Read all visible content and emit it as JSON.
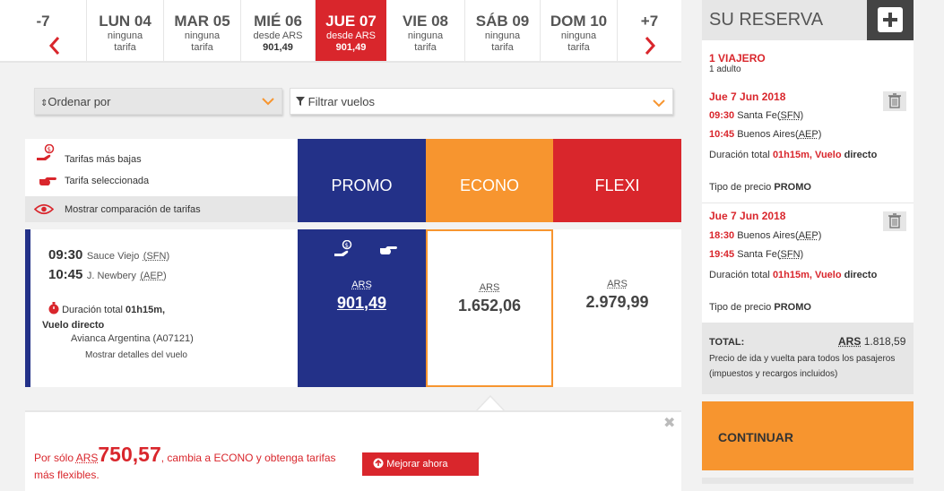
{
  "dates": [
    {
      "day": "-7",
      "sub1": "",
      "sub2": "",
      "active": false,
      "nav": "prev"
    },
    {
      "day": "LUN 04",
      "sub1": "ninguna",
      "sub2": "tarifa",
      "active": false
    },
    {
      "day": "MAR 05",
      "sub1": "ninguna",
      "sub2": "tarifa",
      "active": false
    },
    {
      "day": "MIÉ 06",
      "sub1": "desde ARS",
      "sub2": "901,49",
      "active": false
    },
    {
      "day": "JUE 07",
      "sub1": "desde ARS",
      "sub2": "901,49",
      "active": true
    },
    {
      "day": "VIE 08",
      "sub1": "ninguna",
      "sub2": "tarifa",
      "active": false
    },
    {
      "day": "SÁB 09",
      "sub1": "ninguna",
      "sub2": "tarifa",
      "active": false
    },
    {
      "day": "DOM 10",
      "sub1": "ninguna",
      "sub2": "tarifa",
      "active": false
    },
    {
      "day": "+7",
      "sub1": "",
      "sub2": "",
      "active": false,
      "nav": "next"
    }
  ],
  "filters": {
    "sort_label": "Ordenar por",
    "filter_label": "Filtrar vuelos"
  },
  "legend": {
    "lowest": "Tarifas más bajas",
    "selected": "Tarifa seleccionada",
    "compare": "Mostrar comparación de tarifas"
  },
  "fares": {
    "promo": "PROMO",
    "econo": "ECONO",
    "flexi": "FLEXI"
  },
  "colors": {
    "promo": "#233188",
    "econo": "#f7952f",
    "flexi": "#d9262c",
    "accent_red": "#d9262c"
  },
  "flight": {
    "dep_time": "09:30",
    "dep_place": "Sauce Viejo",
    "dep_code": "SFN",
    "arr_time": "10:45",
    "arr_place": "J. Newbery",
    "arr_code": "AEP",
    "duration_label": "Duración total",
    "duration_value": "01h15m,",
    "direct": "Vuelo directo",
    "carrier": "Avianca Argentina (A07121)",
    "details_link": "Mostrar detalles del vuelo",
    "promo_cur": "ARS",
    "promo_price": "901,49",
    "econo_cur": "ARS",
    "econo_price": "1.652,06",
    "flexi_cur": "ARS",
    "flexi_price": "2.979,99"
  },
  "upsell": {
    "prefix": "Por sólo",
    "cur": "ARS",
    "amount": "750,57",
    "suffix": ", cambia a ECONO y obtenga tarifas",
    "suffix2": "más flexibles.",
    "button": "Mejorar ahora"
  },
  "sidebar": {
    "title": "SU RESERVA",
    "travelers": "1 VIAJERO",
    "adults": "1 adulto",
    "leg1": {
      "date": "Jue 7 Jun 2018",
      "dep_time": "09:30",
      "dep_place": "Santa Fe",
      "dep_code": "SFN",
      "arr_time": "10:45",
      "arr_place": "Buenos Aires",
      "arr_code": "AEP",
      "duration_label": "Duración total",
      "duration_value": "01h15m, Vuelo",
      "duration_value2": "directo",
      "price_type_label": "Tipo de precio",
      "price_type": "PROMO"
    },
    "leg2": {
      "date": "Jue 7 Jun 2018",
      "dep_time": "18:30",
      "dep_place": "Buenos Aires",
      "dep_code": "AEP",
      "arr_time": "19:45",
      "arr_place": "Santa Fe",
      "arr_code": "SFN",
      "duration_label": "Duración total",
      "duration_value": "01h15m, Vuelo",
      "duration_value2": "directo",
      "price_type_label": "Tipo de precio",
      "price_type": "PROMO"
    },
    "total_label": "TOTAL:",
    "total_cur": "ARS",
    "total_amount": "1.818,59",
    "total_note1": "Precio de ida y vuelta para todos los pasajeros",
    "total_note2": "(impuestos y recargos incluidos)",
    "continue": "CONTINUAR"
  }
}
